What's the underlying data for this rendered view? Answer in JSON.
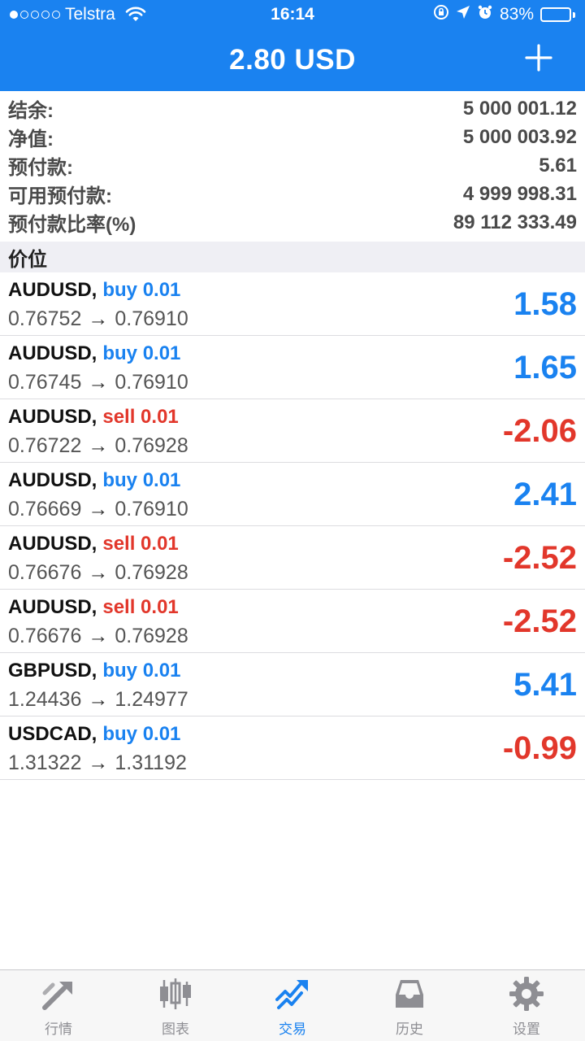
{
  "status_bar": {
    "carrier": "Telstra",
    "time": "16:14",
    "battery": "83%",
    "battery_level": 0.83,
    "signal_dots_filled": 1,
    "signal_dots_total": 5
  },
  "header": {
    "title": "2.80 USD",
    "add_icon": "plus-icon"
  },
  "summary": [
    {
      "label": "结余:",
      "value": "5 000 001.12"
    },
    {
      "label": "净值:",
      "value": "5 000 003.92"
    },
    {
      "label": "预付款:",
      "value": "5.61"
    },
    {
      "label": "可用预付款:",
      "value": "4 999 998.31"
    },
    {
      "label": "预付款比率(%)",
      "value": "89 112 333.49"
    }
  ],
  "section_title": "价位",
  "positions": [
    {
      "symbol": "AUDUSD,",
      "side": "buy",
      "lot": "0.01",
      "open": "0.76752",
      "current": "0.76910",
      "profit": "1.58"
    },
    {
      "symbol": "AUDUSD,",
      "side": "buy",
      "lot": "0.01",
      "open": "0.76745",
      "current": "0.76910",
      "profit": "1.65"
    },
    {
      "symbol": "AUDUSD,",
      "side": "sell",
      "lot": "0.01",
      "open": "0.76722",
      "current": "0.76928",
      "profit": "-2.06"
    },
    {
      "symbol": "AUDUSD,",
      "side": "buy",
      "lot": "0.01",
      "open": "0.76669",
      "current": "0.76910",
      "profit": "2.41"
    },
    {
      "symbol": "AUDUSD,",
      "side": "sell",
      "lot": "0.01",
      "open": "0.76676",
      "current": "0.76928",
      "profit": "-2.52"
    },
    {
      "symbol": "AUDUSD,",
      "side": "sell",
      "lot": "0.01",
      "open": "0.76676",
      "current": "0.76928",
      "profit": "-2.52"
    },
    {
      "symbol": "GBPUSD,",
      "side": "buy",
      "lot": "0.01",
      "open": "1.24436",
      "current": "1.24977",
      "profit": "5.41"
    },
    {
      "symbol": "USDCAD,",
      "side": "buy",
      "lot": "0.01",
      "open": "1.31322",
      "current": "1.31192",
      "profit": "-0.99"
    }
  ],
  "arrow": "→",
  "colors": {
    "brand": "#1a82f0",
    "profit": "#1a82f0",
    "loss": "#e2372b",
    "tab_inactive": "#8e8e93"
  },
  "tabs": [
    {
      "label": "行情",
      "icon": "quotes-icon",
      "active": false
    },
    {
      "label": "图表",
      "icon": "candlestick-chart-icon",
      "active": false
    },
    {
      "label": "交易",
      "icon": "trade-chart-icon",
      "active": true
    },
    {
      "label": "历史",
      "icon": "history-inbox-icon",
      "active": false
    },
    {
      "label": "设置",
      "icon": "gear-icon",
      "active": false
    }
  ]
}
